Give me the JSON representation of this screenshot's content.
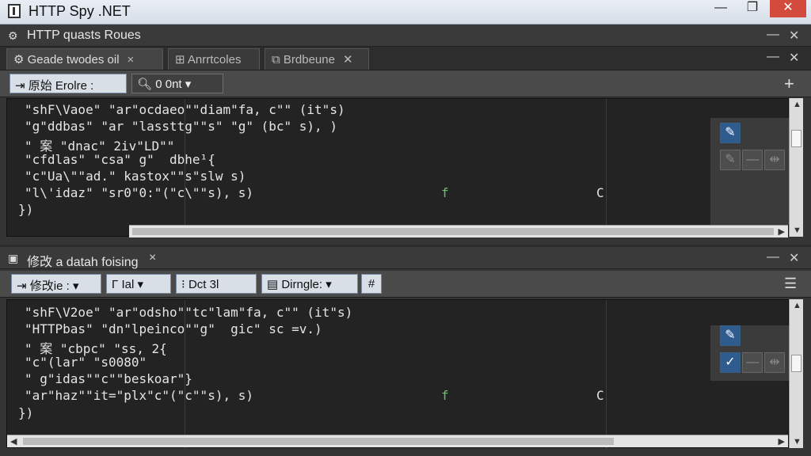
{
  "window": {
    "title": "HTTP Spy .NET",
    "buttons": [
      "—",
      "❐",
      "✕"
    ]
  },
  "top_panel": {
    "title": "HTTP quasts Roues",
    "controls": [
      "—",
      "✕"
    ],
    "tabs": [
      {
        "label": "Geade twodes oil",
        "close": "×"
      },
      {
        "label": "Anrrtcoles",
        "close": ""
      },
      {
        "label": "Brdbeune",
        "close": "✕"
      }
    ],
    "tab_controls": [
      "—",
      "✕"
    ],
    "toolbar": {
      "field1": "原始 Erolre :",
      "field2": "0 0nt",
      "plus": "+"
    },
    "code": [
      "\"shF\\Vaoe\" \"ar\"ocdaeo\"\"diam\"fa, c\"\" (it\"s)",
      "\"g\"ddbas\" \"ar \"lassttg\"\"s\" \"g\" (bc\" s), )",
      "\" 案 \"dnac\" 2iv\"LD\"\"",
      "\"cfdlas\" \"csa\" g\"  dbhe¹{",
      "\"c\"Ua\\\"\"ad.\" kastox\"\"s\"slw s)",
      "\"l\\'idaz\" \"sr0\"0:\"(\"c\\\"\"s), s)",
      "})"
    ],
    "markers": [
      "f",
      "C"
    ]
  },
  "bottom_panel": {
    "title": "修改 a datah foising",
    "close": "×",
    "controls": [
      "—",
      "✕"
    ],
    "toolbar": {
      "field1": "修改ie :",
      "field2": "Ial",
      "field3": "Dct 3l",
      "field4": "Dirngle:",
      "icon": "#"
    },
    "code": [
      "\"shF\\V2oe\" \"ar\"odsho\"\"tc\"lam\"fa, c\"\" (it\"s)",
      "\"HTTPbas\" \"dn\"lpeinco\"\"g\"  gic\" sc =v.)",
      "\" 案 \"cbpc\" \"ss, 2{",
      "\"c\"(lar\" \"s0080\"",
      "\" g\"idas\"\"c\"\"beskoar\"}",
      "\"ar\"haz\"\"it=\"plx\"c\"(\"c\"\"s), s)",
      "})"
    ],
    "markers": [
      "f",
      "C"
    ]
  }
}
